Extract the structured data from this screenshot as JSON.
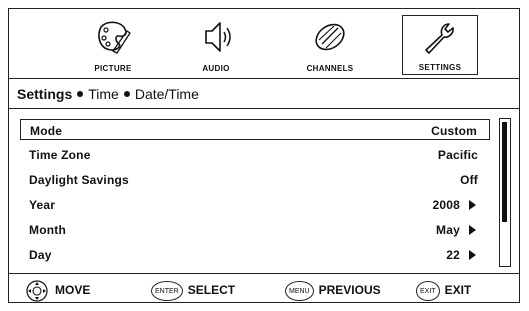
{
  "top_menu": {
    "tabs": [
      {
        "label": "PICTURE",
        "icon": "palette-icon",
        "selected": false
      },
      {
        "label": "AUDIO",
        "icon": "speaker-icon",
        "selected": false
      },
      {
        "label": "CHANNELS",
        "icon": "satellite-dish-icon",
        "selected": false
      },
      {
        "label": "SETTINGS",
        "icon": "wrench-icon",
        "selected": true
      }
    ]
  },
  "breadcrumb": {
    "root": "Settings",
    "items": [
      "Time",
      "Date/Time"
    ]
  },
  "settings": {
    "rows": [
      {
        "label": "Mode",
        "value": "Custom",
        "selected": true,
        "arrow": false
      },
      {
        "label": "Time Zone",
        "value": "Pacific",
        "selected": false,
        "arrow": false
      },
      {
        "label": "Daylight Savings",
        "value": "Off",
        "selected": false,
        "arrow": false
      },
      {
        "label": "Year",
        "value": "2008",
        "selected": false,
        "arrow": true
      },
      {
        "label": "Month",
        "value": "May",
        "selected": false,
        "arrow": true
      },
      {
        "label": "Day",
        "value": "22",
        "selected": false,
        "arrow": true
      }
    ]
  },
  "footer": {
    "move_label": "MOVE",
    "select_key": "ENTER",
    "select_label": "SELECT",
    "previous_key": "MENU",
    "previous_label": "PREVIOUS",
    "exit_key": "EXIT",
    "exit_label": "EXIT"
  }
}
